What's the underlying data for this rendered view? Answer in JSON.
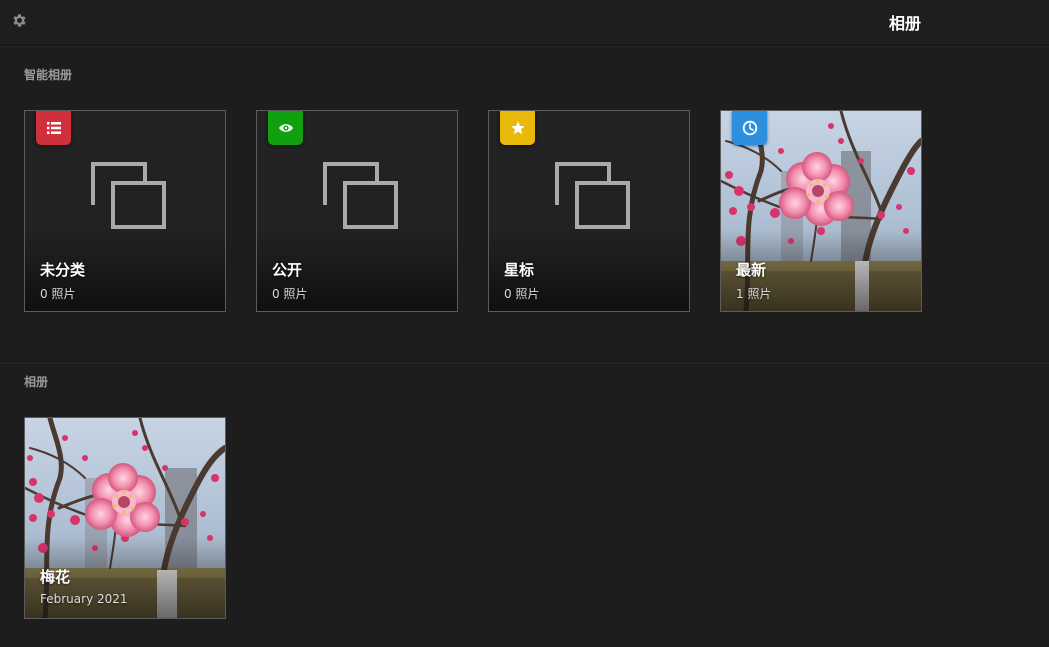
{
  "header": {
    "title": "相册",
    "settings_icon": "gear-icon"
  },
  "smart_section": {
    "title": "智能相册",
    "albums": [
      {
        "name": "未分类",
        "count": "0 照片",
        "badge_icon": "list-icon",
        "badge_color": "#d0303c"
      },
      {
        "name": "公开",
        "count": "0 照片",
        "badge_icon": "eye-icon",
        "badge_color": "#10a010"
      },
      {
        "name": "星标",
        "count": "0 照片",
        "badge_icon": "star-icon",
        "badge_color": "#e8b80a"
      },
      {
        "name": "最新",
        "count": "1 照片",
        "badge_icon": "clock-icon",
        "badge_color": "#2d8fe0"
      }
    ]
  },
  "albums_section": {
    "title": "相册",
    "albums": [
      {
        "name": "梅花",
        "date": "February 2021"
      }
    ]
  },
  "colors": {
    "background": "#1d1d1d",
    "tile_border": "#5c5c5c"
  }
}
